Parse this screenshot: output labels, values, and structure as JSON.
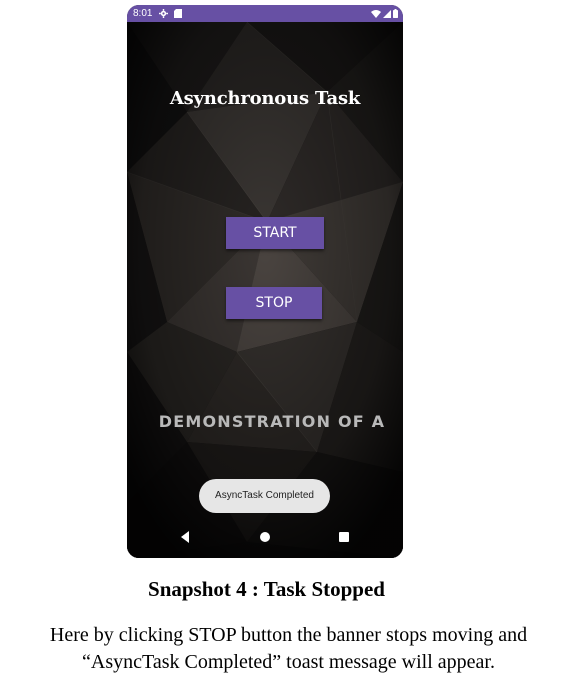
{
  "status_bar": {
    "time": "8:01",
    "left_icons": [
      "gear-icon",
      "sd-card-icon"
    ],
    "right_icons": [
      "wifi-icon",
      "signal-icon",
      "battery-icon"
    ]
  },
  "app": {
    "title": "Asynchronous Task",
    "buttons": {
      "start_label": "START",
      "stop_label": "STOP"
    },
    "banner_text": "DEMONSTRATION OF A",
    "toast_text": "AsyncTask Completed"
  },
  "nav_bar": {
    "items": [
      "back-icon",
      "home-icon",
      "recents-icon"
    ]
  },
  "caption": {
    "title": "Snapshot 4 : Task Stopped",
    "line1": "Here by clicking STOP button the banner stops moving and",
    "line2": "“AsyncTask Completed” toast message will appear."
  },
  "colors": {
    "accent": "#6750a4",
    "background": "#0d0c0c",
    "toast": "#e6e6e6",
    "banner_text": "#b9b9b9"
  }
}
